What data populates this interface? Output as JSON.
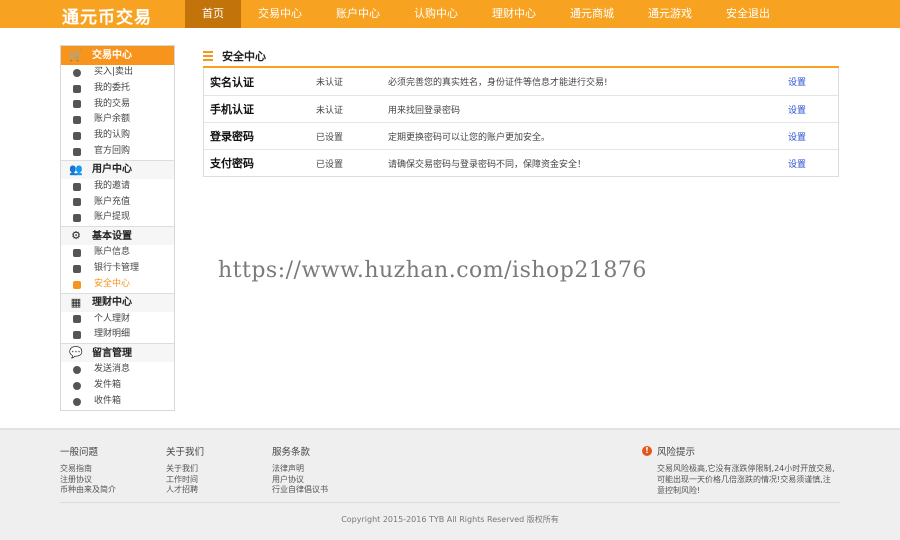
{
  "header": {
    "logo": "通元币交易",
    "nav": [
      {
        "label": "首页",
        "active": true
      },
      {
        "label": "交易中心"
      },
      {
        "label": "账户中心"
      },
      {
        "label": "认购中心"
      },
      {
        "label": "理财中心"
      },
      {
        "label": "通元商城"
      },
      {
        "label": "通元游戏"
      },
      {
        "label": "安全退出"
      }
    ]
  },
  "sidebar": {
    "groups": [
      {
        "title": "交易中心",
        "icon": "cart-icon",
        "items": [
          "买入|卖出",
          "我的委托",
          "我的交易",
          "账户余额",
          "我的认购",
          "官方回购"
        ]
      },
      {
        "title": "用户中心",
        "icon": "user-icon",
        "items": [
          "我的邀请",
          "账户充值",
          "账户提现"
        ]
      },
      {
        "title": "基本设置",
        "icon": "gear-icon",
        "items": [
          "账户信息",
          "银行卡管理",
          "安全中心"
        ]
      },
      {
        "title": "理财中心",
        "icon": "finance-icon",
        "items": [
          "个人理财",
          "理财明细"
        ]
      },
      {
        "title": "留言管理",
        "icon": "message-icon",
        "items": [
          "发送消息",
          "发件箱",
          "收件箱"
        ]
      }
    ],
    "active_item": "安全中心"
  },
  "main": {
    "title": "安全中心",
    "rows": [
      {
        "name": "实名认证",
        "status": "未认证",
        "desc": "必须完善您的真实姓名，身份证件等信息才能进行交易!",
        "action": "设置"
      },
      {
        "name": "手机认证",
        "status": "未认证",
        "desc": "用来找回登录密码",
        "action": "设置"
      },
      {
        "name": "登录密码",
        "status": "已设置",
        "desc": "定期更换密码可以让您的账户更加安全。",
        "action": "设置"
      },
      {
        "name": "支付密码",
        "status": "已设置",
        "desc": "请确保交易密码与登录密码不同，保障资金安全！",
        "action": "设置"
      }
    ]
  },
  "watermark": "https://www.huzhan.com/ishop21876",
  "footer": {
    "columns": [
      {
        "title": "一般问题",
        "links": [
          "交易指南",
          "注册协议",
          "币种由来及简介"
        ]
      },
      {
        "title": "关于我们",
        "links": [
          "关于我们",
          "工作时间",
          "人才招聘"
        ]
      },
      {
        "title": "服务条款",
        "links": [
          "法律声明",
          "用户协议",
          "行业自律倡议书"
        ]
      }
    ],
    "risk": {
      "title": "风险提示",
      "text": "交易风险极高,它没有涨跌停限制,24小时开放交易,可能出现一天价格几倍涨跌的情况!交易须谨慎,注意控制风险!"
    },
    "copyright": "Copyright 2015-2016 TYB All Rights Reserved 版权所有"
  },
  "colors": {
    "accent": "#f7a321",
    "active_nav": "#c2740a",
    "link": "#2a4fd6",
    "footer_bg": "#efefef"
  }
}
